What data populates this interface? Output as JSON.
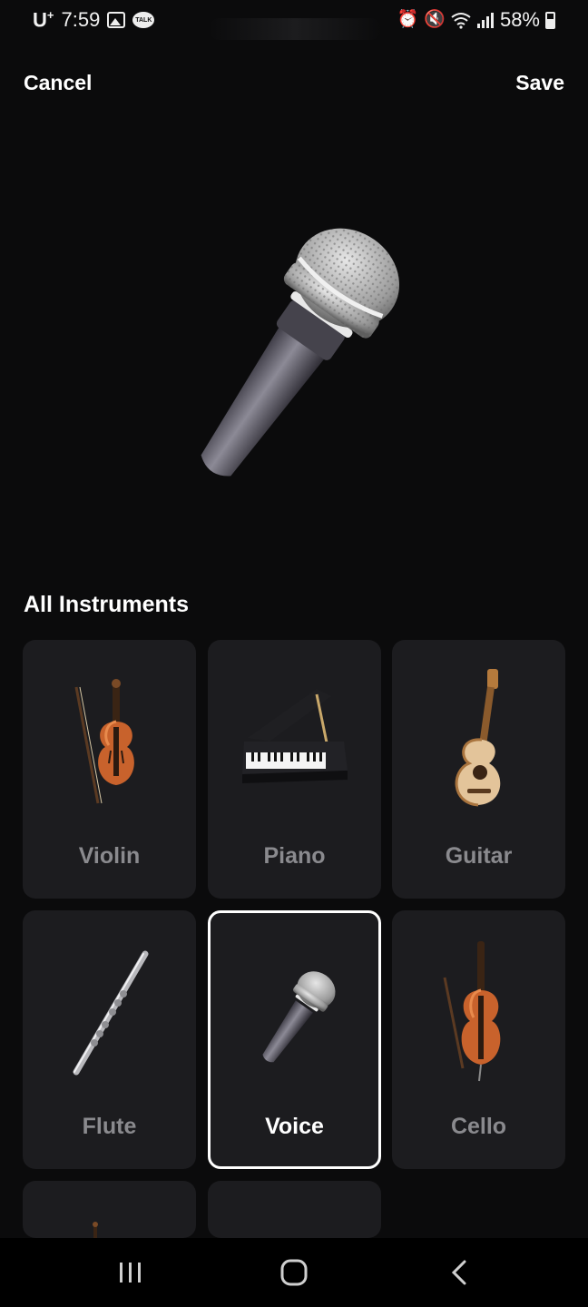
{
  "status_bar": {
    "carrier": "U",
    "carrier_sup": "+",
    "time": "7:59",
    "talk_label": "TALK",
    "battery": "58%",
    "icons": [
      "gallery-icon",
      "kakaotalk-icon",
      "alarm-icon",
      "mute-icon",
      "wifi-icon",
      "signal-icon",
      "battery-icon"
    ]
  },
  "header": {
    "cancel_label": "Cancel",
    "save_label": "Save"
  },
  "preview": {
    "icon": "microphone-icon"
  },
  "section": {
    "title": "All Instruments"
  },
  "instruments": [
    {
      "label": "Violin",
      "icon": "violin-icon",
      "selected": false
    },
    {
      "label": "Piano",
      "icon": "piano-icon",
      "selected": false
    },
    {
      "label": "Guitar",
      "icon": "guitar-icon",
      "selected": false
    },
    {
      "label": "Flute",
      "icon": "flute-icon",
      "selected": false
    },
    {
      "label": "Voice",
      "icon": "microphone-icon",
      "selected": true
    },
    {
      "label": "Cello",
      "icon": "cello-icon",
      "selected": false
    }
  ],
  "colors": {
    "background": "#0b0b0c",
    "card": "#1c1c1f",
    "label_muted": "#8a8a8e",
    "selected_border": "#ffffff"
  },
  "nav": {
    "icons": [
      "recents-icon",
      "home-icon",
      "back-icon"
    ]
  }
}
